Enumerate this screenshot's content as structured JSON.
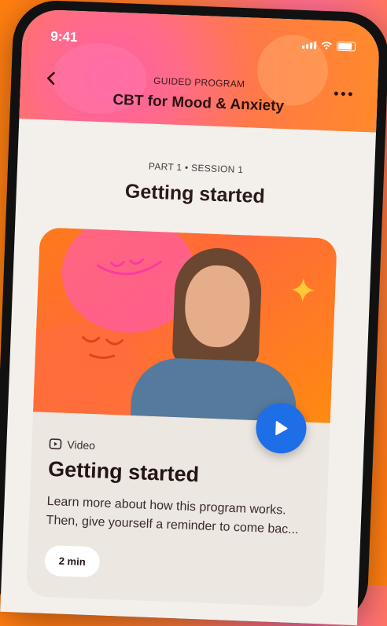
{
  "status_bar": {
    "time": "9:41"
  },
  "header": {
    "eyebrow": "GUIDED PROGRAM",
    "title": "CBT for Mood & Anxiety"
  },
  "session": {
    "part_label": "PART 1 • SESSION 1",
    "title": "Getting started"
  },
  "card": {
    "media_type": "Video",
    "title": "Getting started",
    "description": "Learn more about how this program works. Then, give yourself a reminder to come bac...",
    "duration": "2 min"
  },
  "colors": {
    "accent_blue": "#1e6ee8",
    "header_pink": "#ff5fa4",
    "header_orange": "#ff8a2a",
    "background_orange": "#ff7a12"
  },
  "icons": [
    "back-chevron-icon",
    "more-dots-icon",
    "video-icon",
    "play-icon",
    "signal-icon",
    "wifi-icon",
    "battery-icon"
  ]
}
